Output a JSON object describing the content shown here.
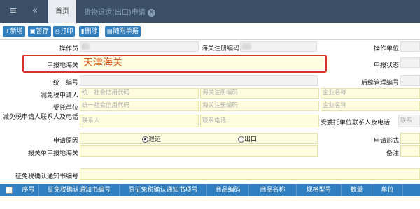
{
  "tabbar": {
    "menu_icon": "hamburger-icon",
    "back_icon": "double-chevron-left-icon",
    "home_tab": "首页",
    "doc_tab": "货物退运(出口)申请"
  },
  "toolbar": {
    "buttons": [
      {
        "label": "新增",
        "icon": "plus-icon"
      },
      {
        "label": "暂存",
        "icon": "save-icon"
      },
      {
        "label": "打印",
        "icon": "print-icon"
      },
      {
        "label": "删除",
        "icon": "trash-icon"
      },
      {
        "label": "随附单据",
        "icon": "attachment-icon"
      }
    ]
  },
  "form": {
    "operator_label": "操作员",
    "customs_reg_label": "海关注册编码",
    "operate_unit_label": "操作单位",
    "declare_customs_label": "申报地海关",
    "declare_customs_value": "天津海关",
    "declare_status_label": "申报状态",
    "unified_no_label": "统一编号",
    "followup_no_label": "后续管理编号",
    "applicant_label": "减免税申请人",
    "applicant_credit_placeholder": "统一社会信用代码",
    "applicant_reg_placeholder": "海关注册编码",
    "applicant_name_placeholder": "企业名称",
    "entrusted_label": "受托单位",
    "entrusted_credit_placeholder": "统一社会信用代码",
    "entrusted_reg_placeholder": "海关注册编码",
    "entrusted_name_placeholder": "企业名称",
    "contact_label": "减免税申请人联系人及电话",
    "contact_person_placeholder": "联系人",
    "contact_phone_placeholder": "联系电话",
    "entrusted_contact_label": "受委托单位联系人及电话",
    "entrusted_contact_placeholder": "联系",
    "reason_label": "申请原因",
    "reason_options": [
      "退运",
      "出口"
    ],
    "reason_selected": "退运",
    "form_type_label": "申请形式",
    "report_customs_label": "报关单申报地海关",
    "remark_label": "备注",
    "notice_no_label": "征免税确认通知书编号"
  },
  "table": {
    "columns": [
      "序号",
      "征免税确认通知书编号",
      "原征免税确认通知书项号",
      "商品编码",
      "商品名称",
      "规格型号",
      "数量",
      "单位"
    ]
  }
}
